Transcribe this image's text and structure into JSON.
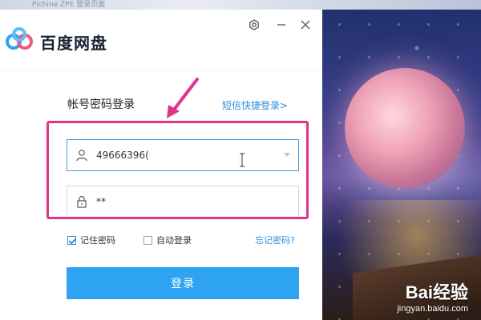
{
  "app": {
    "title": "百度网盘",
    "background_tab_text": "Pichine ZPE 登录页面"
  },
  "window_controls": {
    "settings_icon": "gear-icon",
    "minimize_icon": "minimize-icon",
    "close_icon": "close-icon"
  },
  "login": {
    "title": "帐号密码登录",
    "sms_link": "短信快捷登录>",
    "username": {
      "value": "49666396(",
      "icon": "user-icon"
    },
    "password": {
      "value": "**",
      "icon": "lock-icon"
    },
    "remember_label": "记住密码",
    "remember_checked": true,
    "auto_login_label": "自动登录",
    "auto_login_checked": false,
    "forgot_link": "忘记密码?",
    "submit_label": "登录"
  },
  "annotation": {
    "highlight_color": "#e0338a",
    "arrow_color": "#e0338a"
  },
  "watermark": {
    "title": "Bai经验",
    "url": "jingyan.baidu.com"
  },
  "colors": {
    "accent": "#2ea3f2",
    "link": "#2a8fdc",
    "focus_border": "#3d9be0"
  }
}
